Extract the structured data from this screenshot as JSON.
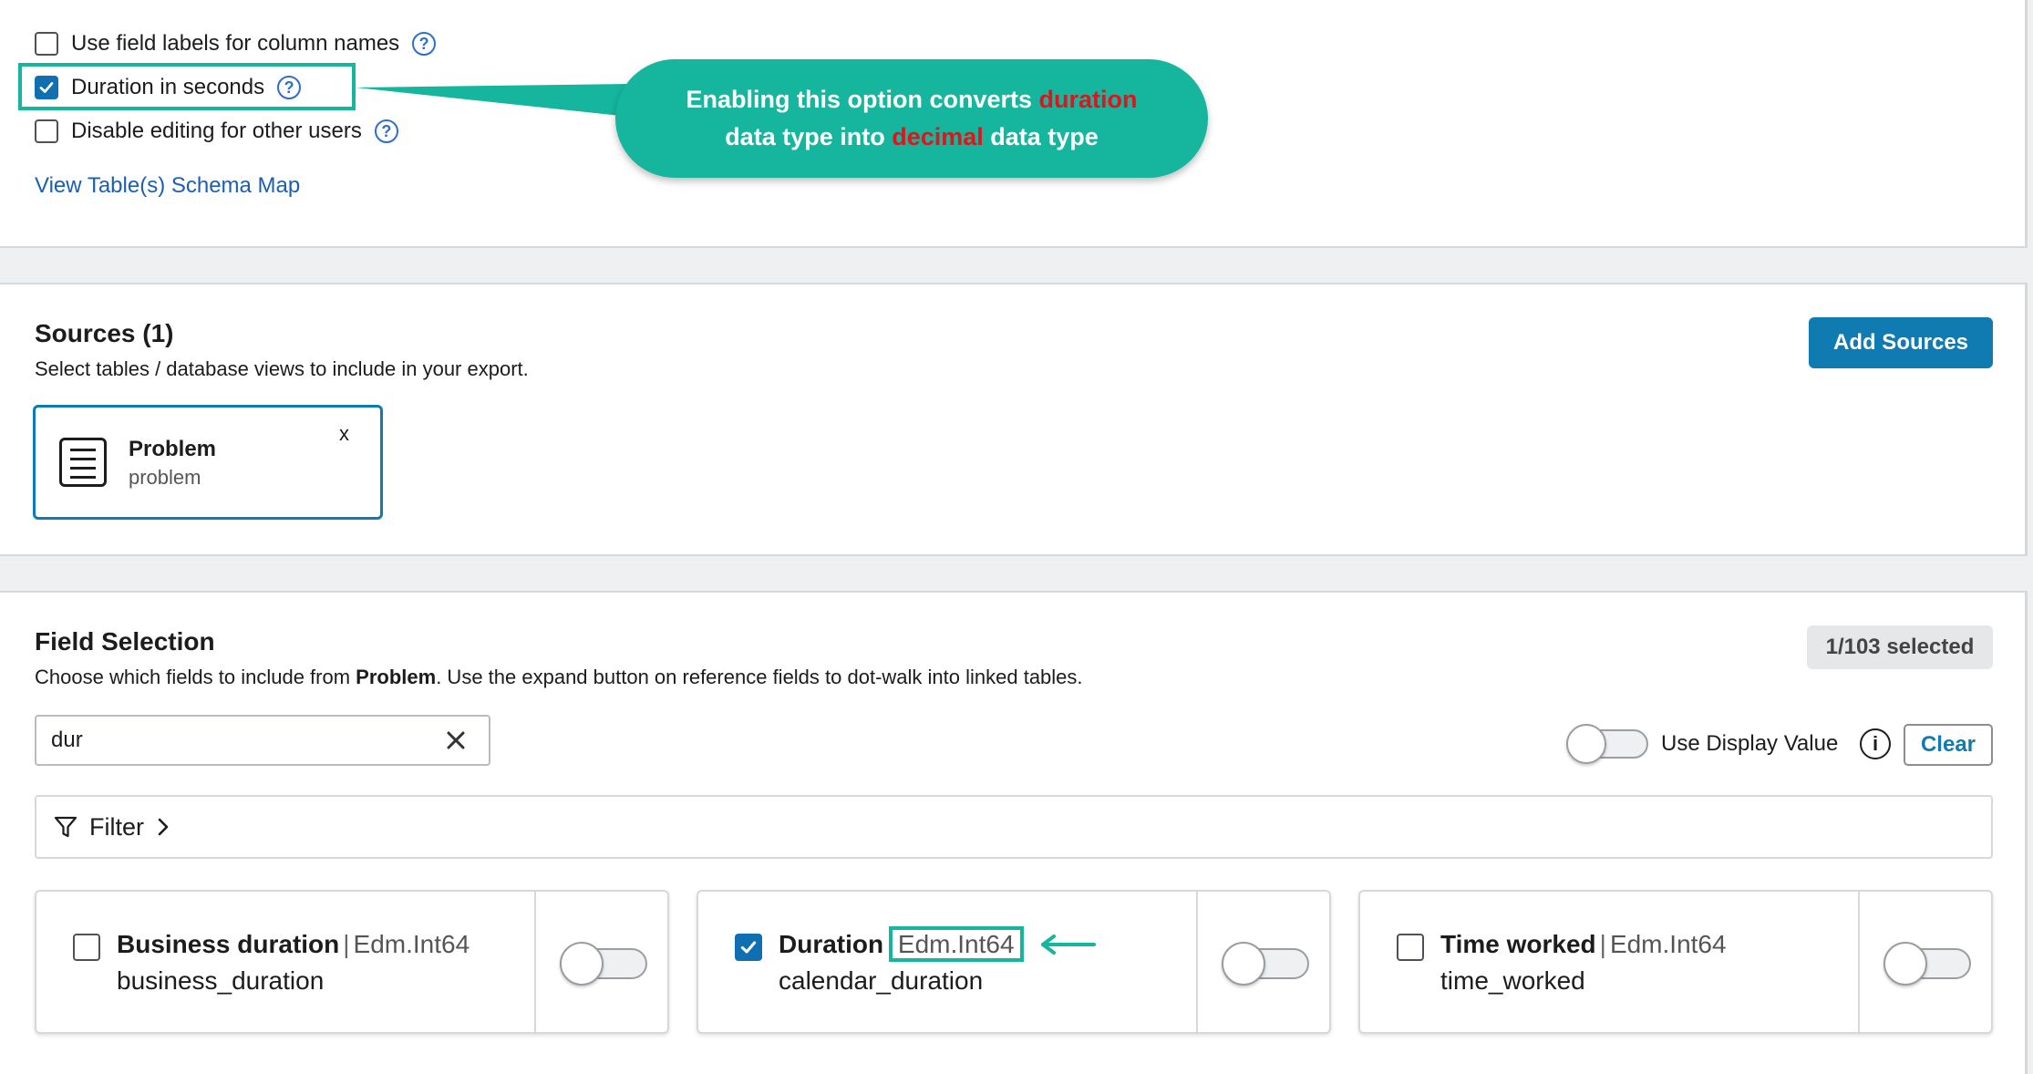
{
  "options": {
    "field_labels": {
      "label": "Use field labels for column names",
      "checked": false
    },
    "duration_seconds": {
      "label": "Duration in seconds",
      "checked": true
    },
    "disable_editing": {
      "label": "Disable editing for other users",
      "checked": false
    },
    "help_glyph": "?",
    "schema_link": "View Table(s) Schema Map"
  },
  "callout": {
    "line1_prefix": "Enabling this option converts ",
    "line1_highlight": "duration",
    "line2_prefix": "data type into ",
    "line2_highlight": "decimal",
    "line2_suffix": " data type"
  },
  "sources": {
    "title": "Sources (1)",
    "subtitle": "Select tables / database views to include in your export.",
    "add_button": "Add Sources",
    "items": [
      {
        "title": "Problem",
        "name": "problem",
        "remove": "x"
      }
    ]
  },
  "field_selection": {
    "title": "Field Selection",
    "subtitle_prefix": "Choose which fields to include from ",
    "subtitle_table": "Problem",
    "subtitle_suffix": ". Use the expand button on reference fields to dot-walk into linked tables.",
    "selected_badge": "1/103 selected",
    "search_value": "dur",
    "display_value_label": "Use Display Value",
    "display_value_on": false,
    "info_glyph": "i",
    "clear_button": "Clear",
    "filter_label": "Filter",
    "separator": "|",
    "fields": [
      {
        "label": "Business duration",
        "type": "Edm.Int64",
        "column": "business_duration",
        "checked": false
      },
      {
        "label": "Duration",
        "type": "Edm.Int64",
        "column": "calendar_duration",
        "checked": true
      },
      {
        "label": "Time worked",
        "type": "Edm.Int64",
        "column": "time_worked",
        "checked": false
      }
    ]
  },
  "colors": {
    "accent": "#16b59d",
    "primary": "#0f7bb0",
    "highlight_red": "#e3131b"
  }
}
